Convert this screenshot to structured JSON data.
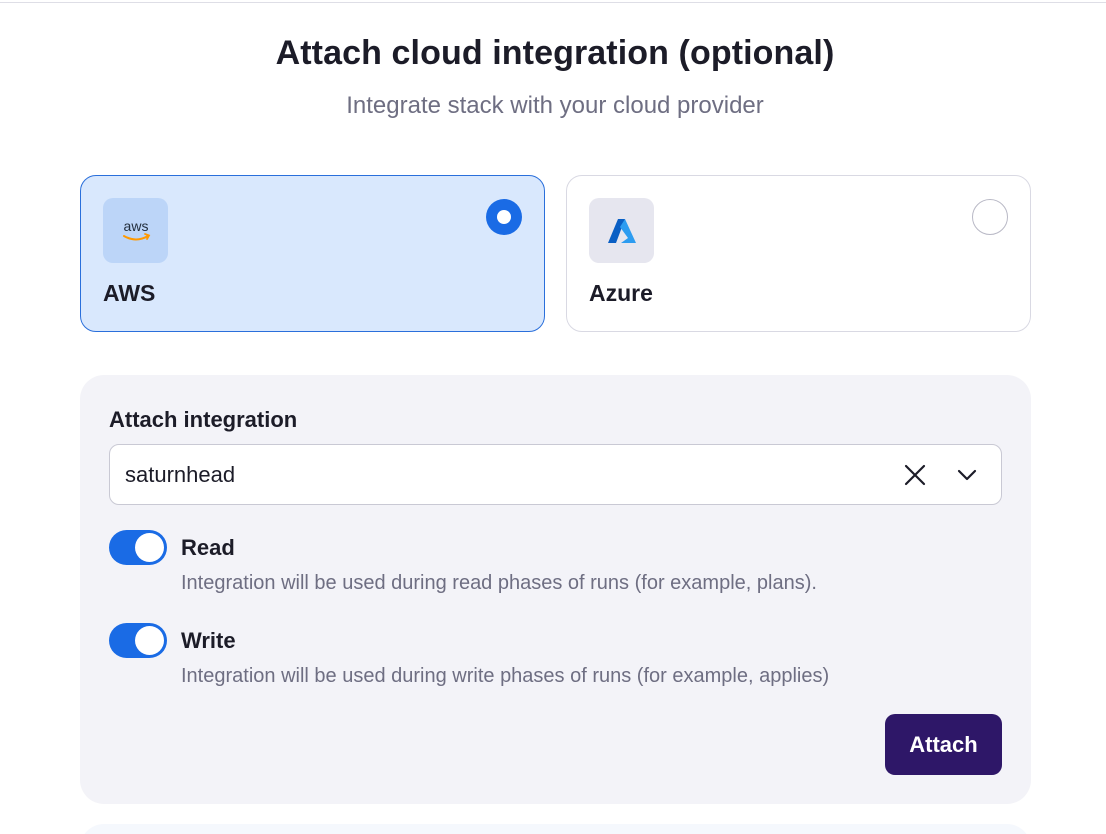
{
  "header": {
    "title": "Attach cloud integration (optional)",
    "subtitle": "Integrate stack with your cloud provider"
  },
  "providers": [
    {
      "name": "AWS",
      "logo_text": "aws",
      "icon": "aws-logo-icon",
      "selected": true
    },
    {
      "name": "Azure",
      "icon": "azure-logo-icon",
      "selected": false
    }
  ],
  "integration": {
    "label": "Attach integration",
    "value": "saturnhead",
    "clear_icon": "close-icon",
    "dropdown_icon": "chevron-down-icon"
  },
  "permissions": {
    "read": {
      "label": "Read",
      "description": "Integration will be used during read phases of runs (for example, plans).",
      "enabled": true
    },
    "write": {
      "label": "Write",
      "description": "Integration will be used during write phases of runs (for example, applies)",
      "enabled": true
    }
  },
  "actions": {
    "attach_label": "Attach"
  },
  "colors": {
    "accent": "#1a6be5",
    "primary_button": "#2e1768",
    "selected_card": "#d9e8fd"
  }
}
